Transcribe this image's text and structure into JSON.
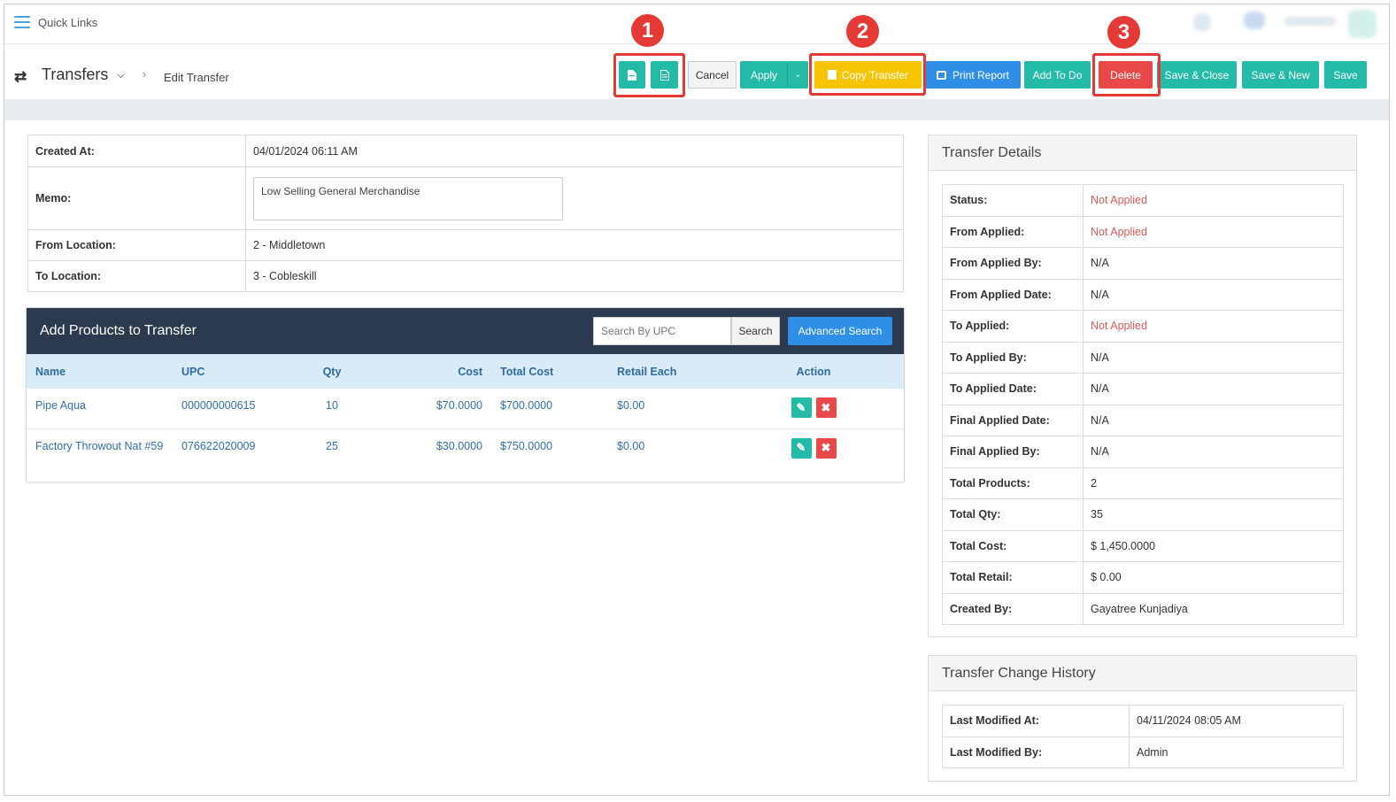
{
  "quick_links": {
    "label": "Quick Links"
  },
  "header": {
    "title": "Transfers",
    "breadcrumb": "Edit Transfer"
  },
  "toolbar": {
    "cancel": "Cancel",
    "apply": "Apply",
    "copy_transfer": "Copy Transfer",
    "print_report": "Print Report",
    "add_to_do": "Add To Do",
    "delete": "Delete",
    "save_close": "Save & Close",
    "save_new": "Save & New",
    "save": "Save"
  },
  "annotations": [
    "1",
    "2",
    "3"
  ],
  "info": {
    "created_at_label": "Created At:",
    "created_at": "04/01/2024 06:11 AM",
    "memo_label": "Memo:",
    "memo": "Low Selling General Merchandise",
    "from_location_label": "From Location:",
    "from_location": "2 - Middletown",
    "to_location_label": "To Location:",
    "to_location": "3 - Cobleskill"
  },
  "products": {
    "title": "Add Products to Transfer",
    "search_placeholder": "Search By UPC",
    "search_button": "Search",
    "advanced_search": "Advanced Search",
    "columns": [
      "Name",
      "UPC",
      "Qty",
      "Cost",
      "Total Cost",
      "Retail Each",
      "Action"
    ],
    "rows": [
      {
        "name": "Pipe Aqua",
        "upc": "000000000615",
        "qty": "10",
        "cost": "$70.0000",
        "total_cost": "$700.0000",
        "retail_each": "$0.00"
      },
      {
        "name": "Factory Throwout Nat #59",
        "upc": "076622020009",
        "qty": "25",
        "cost": "$30.0000",
        "total_cost": "$750.0000",
        "retail_each": "$0.00"
      }
    ]
  },
  "transfer_details": {
    "title": "Transfer Details",
    "rows": [
      {
        "label": "Status:",
        "value": "Not Applied"
      },
      {
        "label": "From Applied:",
        "value": "Not Applied"
      },
      {
        "label": "From Applied By:",
        "value": "N/A"
      },
      {
        "label": "From Applied Date:",
        "value": "N/A"
      },
      {
        "label": "To Applied:",
        "value": "Not Applied"
      },
      {
        "label": "To Applied By:",
        "value": "N/A"
      },
      {
        "label": "To Applied Date:",
        "value": "N/A"
      },
      {
        "label": "Final Applied Date:",
        "value": "N/A"
      },
      {
        "label": "Final Applied By:",
        "value": "N/A"
      },
      {
        "label": "Total Products:",
        "value": "2"
      },
      {
        "label": "Total Qty:",
        "value": "35"
      },
      {
        "label": "Total Cost:",
        "value": "$ 1,450.0000"
      },
      {
        "label": "Total Retail:",
        "value": "$ 0.00"
      },
      {
        "label": "Created By:",
        "value": "Gayatree Kunjadiya"
      }
    ]
  },
  "change_history": {
    "title": "Transfer Change History",
    "rows": [
      {
        "label": "Last Modified At:",
        "value": "04/11/2024 08:05 AM"
      },
      {
        "label": "Last Modified By:",
        "value": "Admin"
      }
    ]
  },
  "colors": {
    "teal": "#23bba7",
    "blue": "#2f8fe6",
    "yellow": "#f6c400",
    "red": "#e84848",
    "status_red": "#e05a5a",
    "table_header": "#2b3a4e"
  }
}
